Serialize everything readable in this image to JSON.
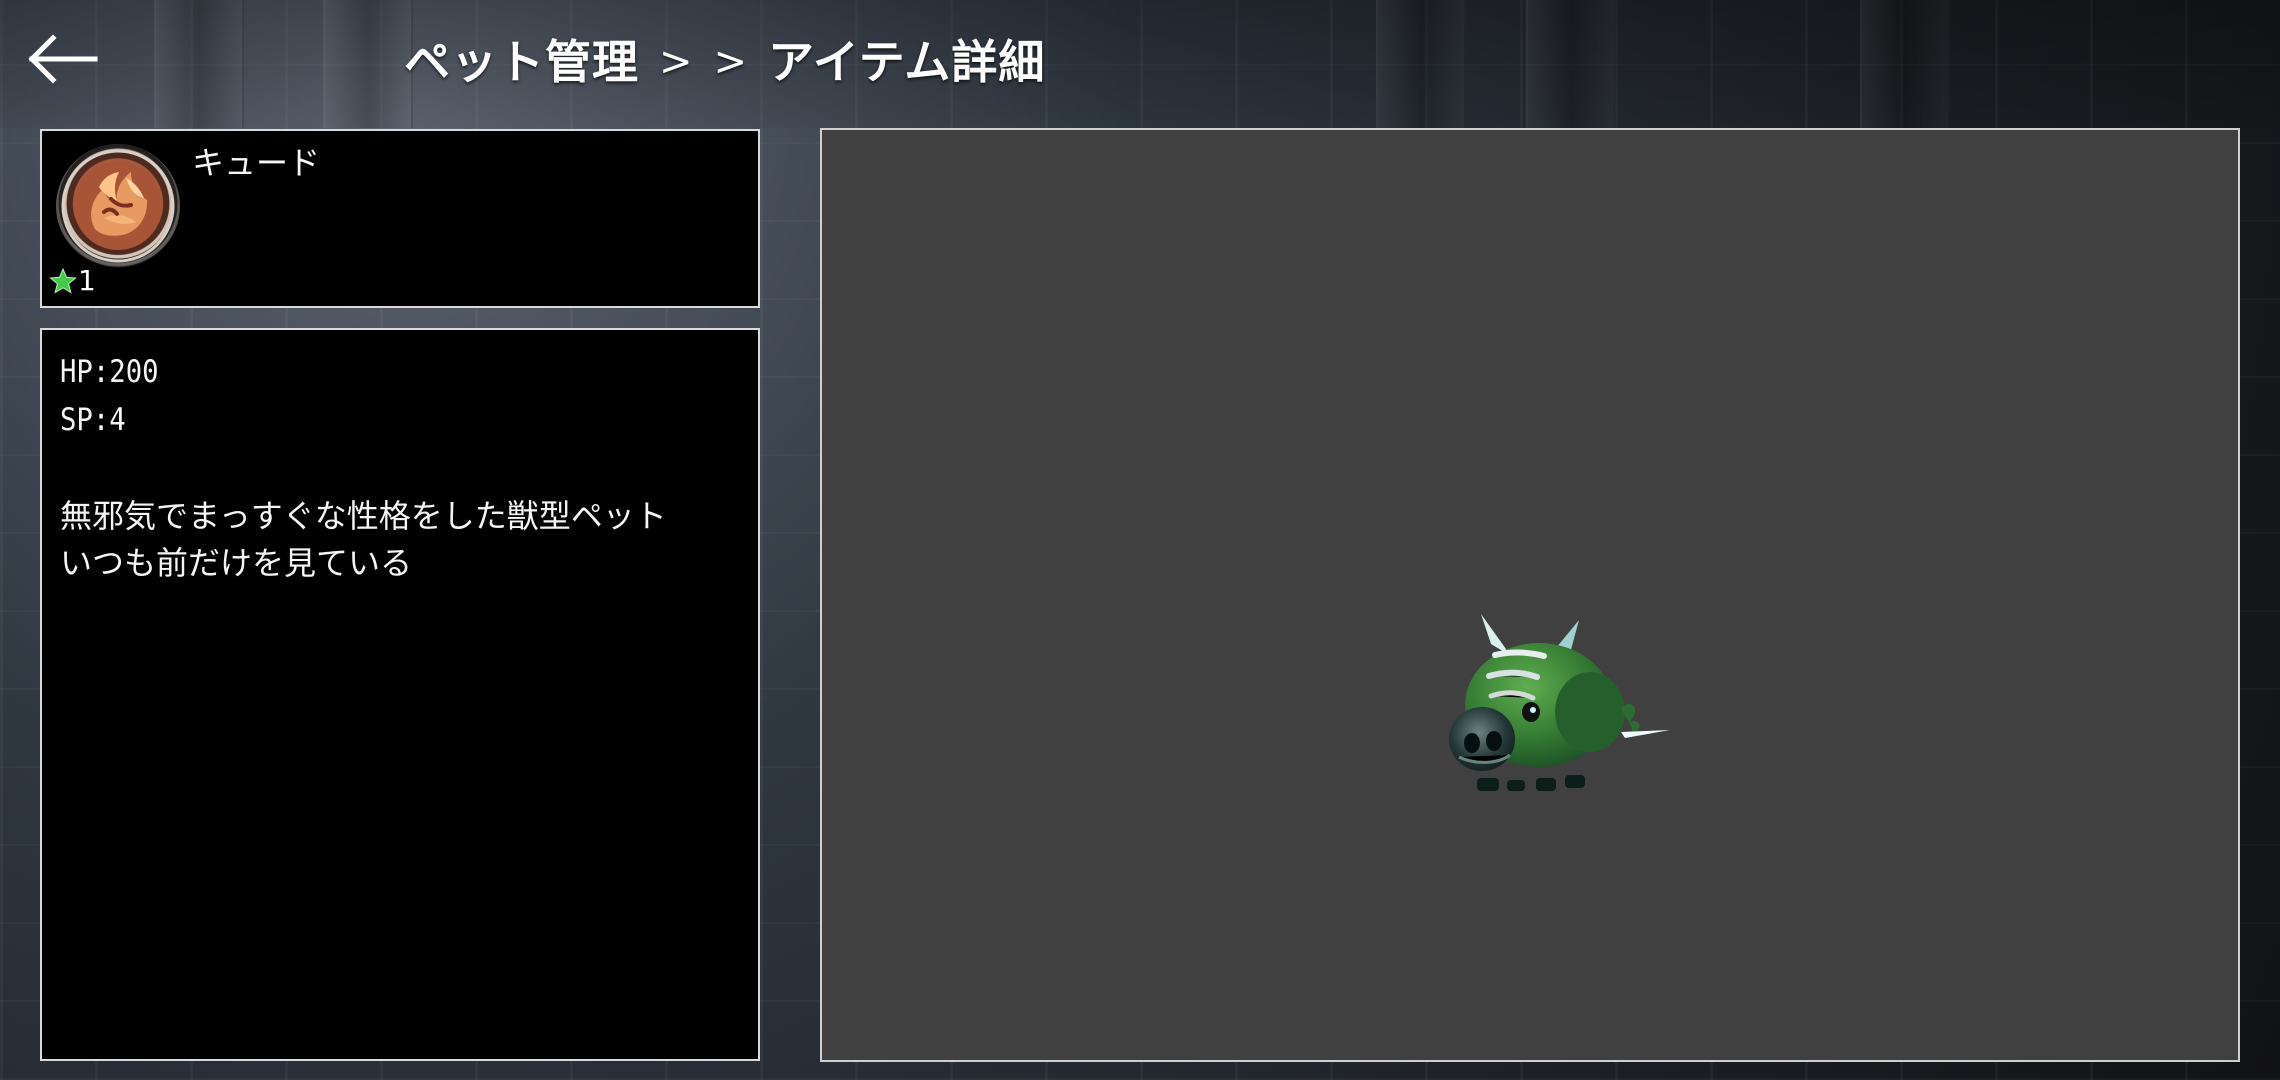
{
  "window": {
    "title": ""
  },
  "navigation": {
    "back_icon": "back-arrow-icon",
    "breadcrumb": [
      "ペット管理",
      ">",
      ">",
      "アイテム詳細"
    ]
  },
  "pet": {
    "name": "キュード",
    "icon": "fox-medallion-icon",
    "rarity": {
      "icon": "star-icon",
      "value": "1"
    },
    "stats": {
      "hp": "HP:200",
      "sp": "SP:4"
    },
    "description": "無邪気でまっすぐな性格をした獣型ペット\nいつも前だけを見ている"
  },
  "viewer": {
    "model": "green-boar-pet-model"
  },
  "colors": {
    "panel_background": "#000000",
    "panel_border": "#d9d9d9",
    "viewer_background": "#404040",
    "text": "#ffffff",
    "rarity_star": "#43c84a",
    "pet_green": "#3f8b38"
  }
}
